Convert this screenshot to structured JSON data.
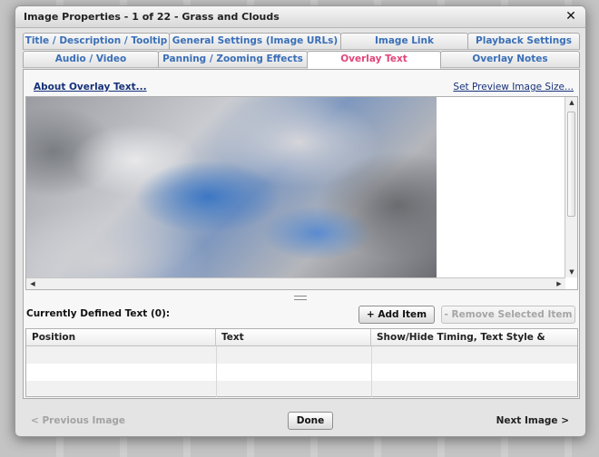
{
  "window": {
    "title": "Image Properties - 1 of 22 - Grass and Clouds",
    "close_glyph": "✕"
  },
  "tabs": {
    "row1": [
      {
        "label": "Title / Description / Tooltip"
      },
      {
        "label": "General Settings (Image URLs)"
      },
      {
        "label": "Image Link"
      },
      {
        "label": "Playback Settings"
      }
    ],
    "row2": [
      {
        "label": "Audio / Video"
      },
      {
        "label": "Panning / Zooming Effects"
      },
      {
        "label": "Overlay Text",
        "active": true
      },
      {
        "label": "Overlay Notes"
      }
    ]
  },
  "panel": {
    "about_link": "About Overlay Text...",
    "preview_size_link": "Set Preview Image Size...",
    "defined_text_label": "Currently Defined Text (0):",
    "add_item_label": "+ Add Item",
    "remove_item_label": "- Remove Selected Item"
  },
  "table": {
    "columns": [
      "Position",
      "Text",
      "Show/Hide Timing, Text Style & Effects"
    ],
    "rows": []
  },
  "footer": {
    "previous_label": "< Previous Image",
    "done_label": "Done",
    "next_label": "Next Image >"
  },
  "colors": {
    "tab_text": "#3a6fb7",
    "active_tab_text": "#e0457a",
    "link_text": "#16317a"
  },
  "icons": {
    "scroll_up": "▲",
    "scroll_down": "▼",
    "scroll_left": "◀",
    "scroll_right": "▶"
  }
}
